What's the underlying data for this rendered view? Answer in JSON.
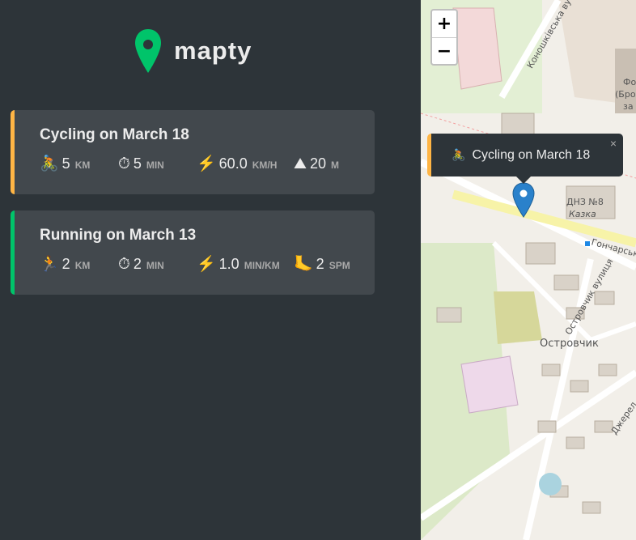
{
  "app": {
    "name": "mapty",
    "brand_color": "#00c46a"
  },
  "workouts": [
    {
      "type": "cycling",
      "accent_color": "#ffb545",
      "title": "Cycling on March 18",
      "stats": [
        {
          "icon": "🚴",
          "icon_name": "cycling-icon",
          "value": "5",
          "unit": "km"
        },
        {
          "icon": "⏱",
          "icon_name": "stopwatch-icon",
          "value": "5",
          "unit": "min"
        },
        {
          "icon": "⚡",
          "icon_name": "lightning-icon",
          "value": "60.0",
          "unit": "km/h"
        },
        {
          "icon": "⛰",
          "icon_name": "mountain-icon",
          "value": "20",
          "unit": "m"
        }
      ]
    },
    {
      "type": "running",
      "accent_color": "#00c46a",
      "title": "Running on March 13",
      "stats": [
        {
          "icon": "🏃",
          "icon_name": "running-icon",
          "value": "2",
          "unit": "km"
        },
        {
          "icon": "⏱",
          "icon_name": "stopwatch-icon",
          "value": "2",
          "unit": "min"
        },
        {
          "icon": "⚡",
          "icon_name": "lightning-icon",
          "value": "1.0",
          "unit": "min/km"
        },
        {
          "icon": "🦶",
          "icon_name": "foot-icon",
          "value": "2",
          "unit": "spm"
        }
      ]
    }
  ],
  "map": {
    "zoom_in_label": "+",
    "zoom_out_label": "−",
    "popup": {
      "icon": "🚴",
      "text": "Cycling on March 18",
      "close": "×"
    },
    "labels": {
      "street_1": "Коношківська ву",
      "street_2": "Гончарськ",
      "street_3": "Островчик вулиця",
      "street_4": "Джерел",
      "place_1": "ДНЗ №8",
      "place_2": "Казка",
      "district": "Островчик",
      "building_1": "Фо",
      "building_2": "(Брод",
      "building_3": "за"
    }
  }
}
